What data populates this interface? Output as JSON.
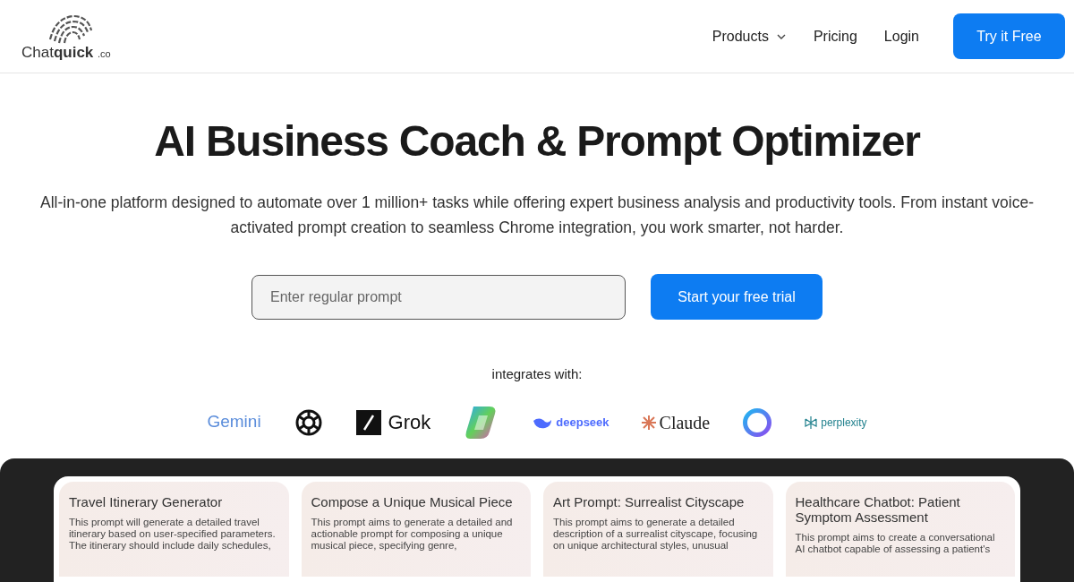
{
  "header": {
    "logo": {
      "word": "Chat",
      "bold": "quick",
      "suffix": ".co"
    },
    "nav": [
      {
        "label": "Products",
        "kind": "dropdown"
      },
      {
        "label": "Pricing",
        "kind": "link"
      },
      {
        "label": "Login",
        "kind": "link"
      }
    ],
    "cta": "Try it Free"
  },
  "hero": {
    "title": "AI Business Coach & Prompt Optimizer",
    "subtitle": "All-in-one platform designed to automate over 1 million+ tasks while offering expert business analysis and productivity tools. From instant voice-activated prompt creation to seamless Chrome integration, you work smarter, not harder.",
    "prompt": {
      "placeholder": "Enter regular prompt"
    },
    "button": "Start your free trial"
  },
  "integrations": {
    "label": "integrates with:",
    "logos": [
      {
        "kind": "gemini",
        "text": "Gemini"
      },
      {
        "kind": "openai"
      },
      {
        "kind": "grok",
        "text": "Grok"
      },
      {
        "kind": "copilot"
      },
      {
        "kind": "deepseek",
        "text": "deepseek"
      },
      {
        "kind": "claude",
        "text": "Claude"
      },
      {
        "kind": "ring"
      },
      {
        "kind": "perplexity",
        "text": "perplexity"
      }
    ]
  },
  "cards": [
    {
      "title": "Travel Itinerary Generator",
      "body": "This prompt will generate a detailed travel itinerary based on user-specified parameters. The itinerary should include daily schedules,"
    },
    {
      "title": "Compose a Unique Musical Piece",
      "body": "This prompt aims to generate a detailed and actionable prompt for composing a unique musical piece, specifying genre,"
    },
    {
      "title": "Art Prompt: Surrealist Cityscape",
      "body": "This prompt aims to generate a detailed description of a surrealist cityscape, focusing on unique architectural styles, unusual"
    },
    {
      "title": "Healthcare Chatbot: Patient Symptom Assessment",
      "body": "This prompt aims to create a conversational AI chatbot capable of assessing a patient's"
    }
  ]
}
